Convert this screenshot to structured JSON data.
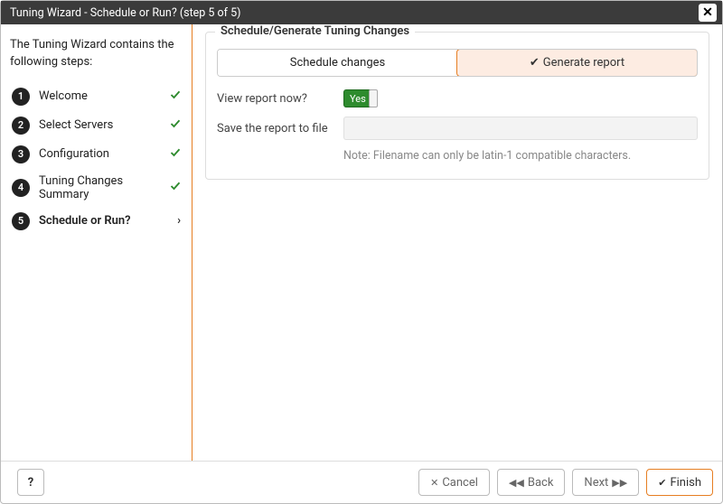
{
  "titlebar": {
    "title": "Tuning Wizard - Schedule or Run? (step 5 of 5)"
  },
  "sidebar": {
    "intro": "The Tuning Wizard contains the following steps:",
    "steps": [
      {
        "num": "1",
        "label": "Welcome",
        "done": true,
        "current": false
      },
      {
        "num": "2",
        "label": "Select Servers",
        "done": true,
        "current": false
      },
      {
        "num": "3",
        "label": "Configuration",
        "done": true,
        "current": false
      },
      {
        "num": "4",
        "label": "Tuning Changes Summary",
        "done": true,
        "current": false
      },
      {
        "num": "5",
        "label": "Schedule or Run?",
        "done": false,
        "current": true
      }
    ]
  },
  "panel": {
    "legend": "Schedule/Generate Tuning Changes",
    "tabs": {
      "schedule": "Schedule changes",
      "generate": "Generate report"
    },
    "view_now_label": "View report now?",
    "toggle_text": "Yes",
    "save_label": "Save the report to file",
    "save_value": "",
    "note": "Note: Filename can only be latin-1 compatible characters."
  },
  "footer": {
    "help": "?",
    "cancel": "Cancel",
    "back": "Back",
    "next": "Next",
    "finish": "Finish"
  }
}
